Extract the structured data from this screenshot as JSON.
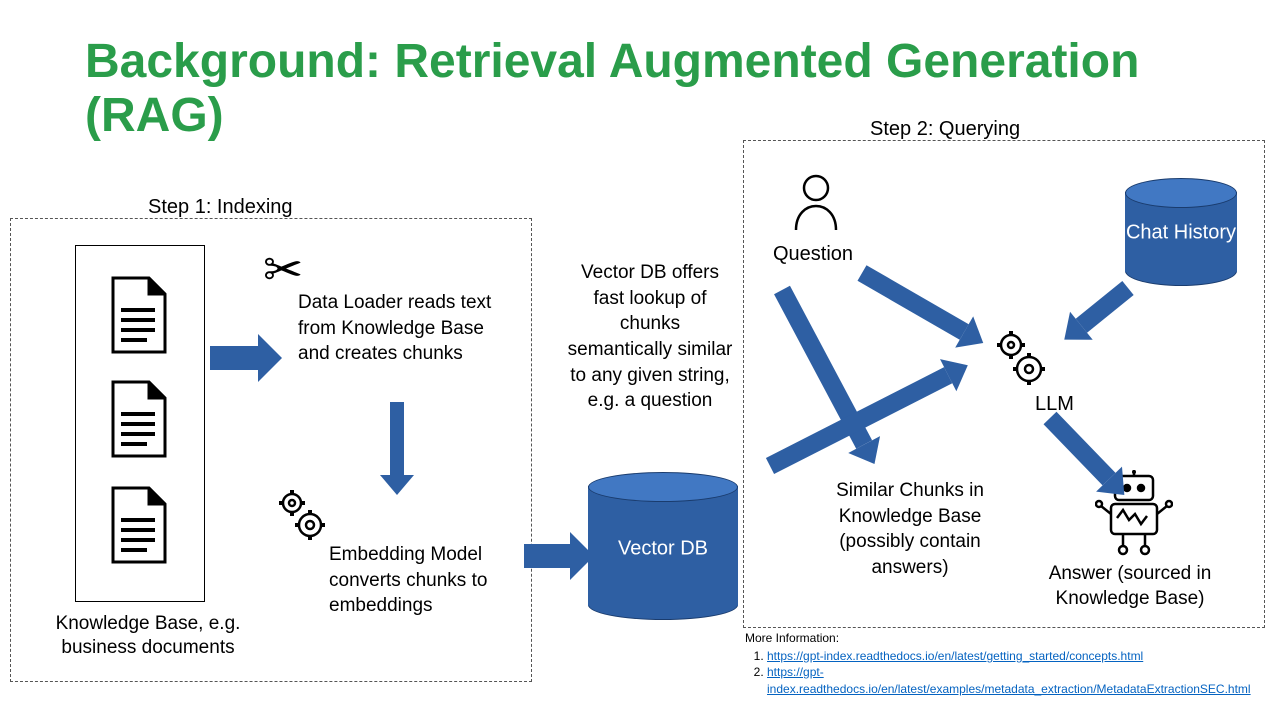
{
  "title": "Background: Retrieval Augmented Generation (RAG)",
  "steps": {
    "one": "Step 1: Indexing",
    "two": "Step 2: Querying"
  },
  "indexing": {
    "kb_caption": "Knowledge Base, e.g. business documents",
    "loader": "Data Loader reads text from Knowledge Base and creates chunks",
    "embedder": "Embedding Model converts chunks to embeddings",
    "vectordb": "Vector DB",
    "vectordb_note": "Vector DB offers fast lookup of chunks semantically similar to any given string, e.g. a question"
  },
  "querying": {
    "question": "Question",
    "chat_history": "Chat History",
    "llm": "LLM",
    "chunks": "Similar Chunks in Knowledge Base (possibly contain answers)",
    "answer": "Answer (sourced in Knowledge Base)"
  },
  "more": {
    "header": "More Information:",
    "link1": "https://gpt-index.readthedocs.io/en/latest/getting_started/concepts.html",
    "link2": "https://gpt-index.readthedocs.io/en/latest/examples/metadata_extraction/MetadataExtractionSEC.html"
  }
}
